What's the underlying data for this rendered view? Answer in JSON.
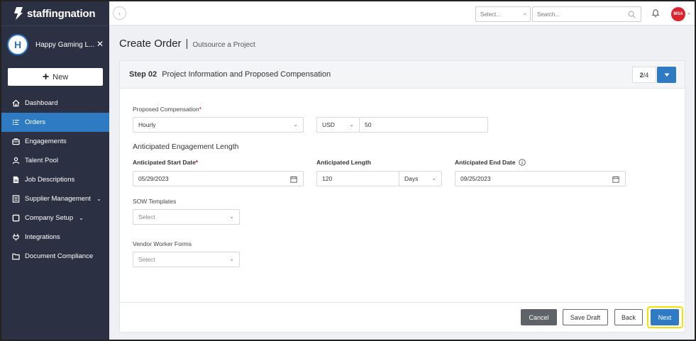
{
  "brand": {
    "name": "staffingnation"
  },
  "company": {
    "initial": "H",
    "name": "Happy Gaming L..."
  },
  "sidebar": {
    "new_label": "New",
    "items": [
      {
        "label": "Dashboard",
        "icon": "home-icon"
      },
      {
        "label": "Orders",
        "icon": "list-icon",
        "active": true
      },
      {
        "label": "Engagements",
        "icon": "briefcase-icon"
      },
      {
        "label": "Talent Pool",
        "icon": "person-icon"
      },
      {
        "label": "Job Descriptions",
        "icon": "document-icon"
      },
      {
        "label": "Supplier Management",
        "icon": "ledger-icon",
        "has_caret": true
      },
      {
        "label": "Company Setup",
        "icon": "square-icon",
        "has_caret": true
      },
      {
        "label": "Integrations",
        "icon": "plug-icon"
      },
      {
        "label": "Document Compliance",
        "icon": "folder-icon"
      }
    ]
  },
  "topbar": {
    "select_placeholder": "Select...",
    "search_placeholder": "Search...",
    "user_initials": "MSA"
  },
  "page": {
    "title": "Create Order",
    "subtitle": "Outsource a Project"
  },
  "step": {
    "label": "Step 02",
    "title": "Project Information and Proposed Compensation",
    "current": "2",
    "total": "/4"
  },
  "form": {
    "comp_label": "Proposed Compensation",
    "comp_type": "Hourly",
    "currency": "USD",
    "amount": "50",
    "length_section": "Anticipated Engagement Length",
    "start_label": "Anticipated Start Date",
    "start_value": "05/29/2023",
    "length_label": "Anticipated Length",
    "length_value": "120",
    "length_unit": "Days",
    "end_label": "Anticipated End Date",
    "end_value": "09/25/2023",
    "sow_label": "SOW Templates",
    "sow_placeholder": "Select",
    "vendor_label": "Vendor Worker Forms",
    "vendor_placeholder": "Select"
  },
  "footer": {
    "cancel": "Cancel",
    "save_draft": "Save Draft",
    "back": "Back",
    "next": "Next"
  },
  "colors": {
    "sidebar_bg": "#2b3142",
    "accent": "#2e7bc4",
    "highlight": "#f3e300",
    "required": "#d0021b"
  }
}
